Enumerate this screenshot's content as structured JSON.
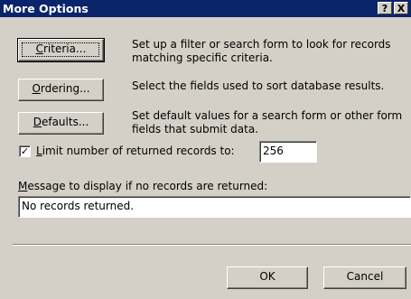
{
  "window": {
    "title": "More Options",
    "help_label": "?",
    "close_label": "X"
  },
  "criteria": {
    "label_pre": "",
    "label_key": "C",
    "label_post": "riteria...",
    "description": "Set up a filter or search form to look for records matching specific criteria."
  },
  "ordering": {
    "label_pre": "",
    "label_key": "O",
    "label_post": "rdering...",
    "description": "Select the fields used to sort database results."
  },
  "defaults": {
    "label_pre": "",
    "label_key": "D",
    "label_post": "efaults...",
    "description": "Set default values for a search form or other form fields that submit data."
  },
  "limit": {
    "checked": true,
    "check_glyph": "✓",
    "label_key": "L",
    "label_post": "imit number of returned records to:",
    "value": "256"
  },
  "message": {
    "label_key": "M",
    "label_post": "essage to display if no records are returned:",
    "value": "No records returned."
  },
  "footer": {
    "ok_label": "OK",
    "cancel_label": "Cancel"
  }
}
